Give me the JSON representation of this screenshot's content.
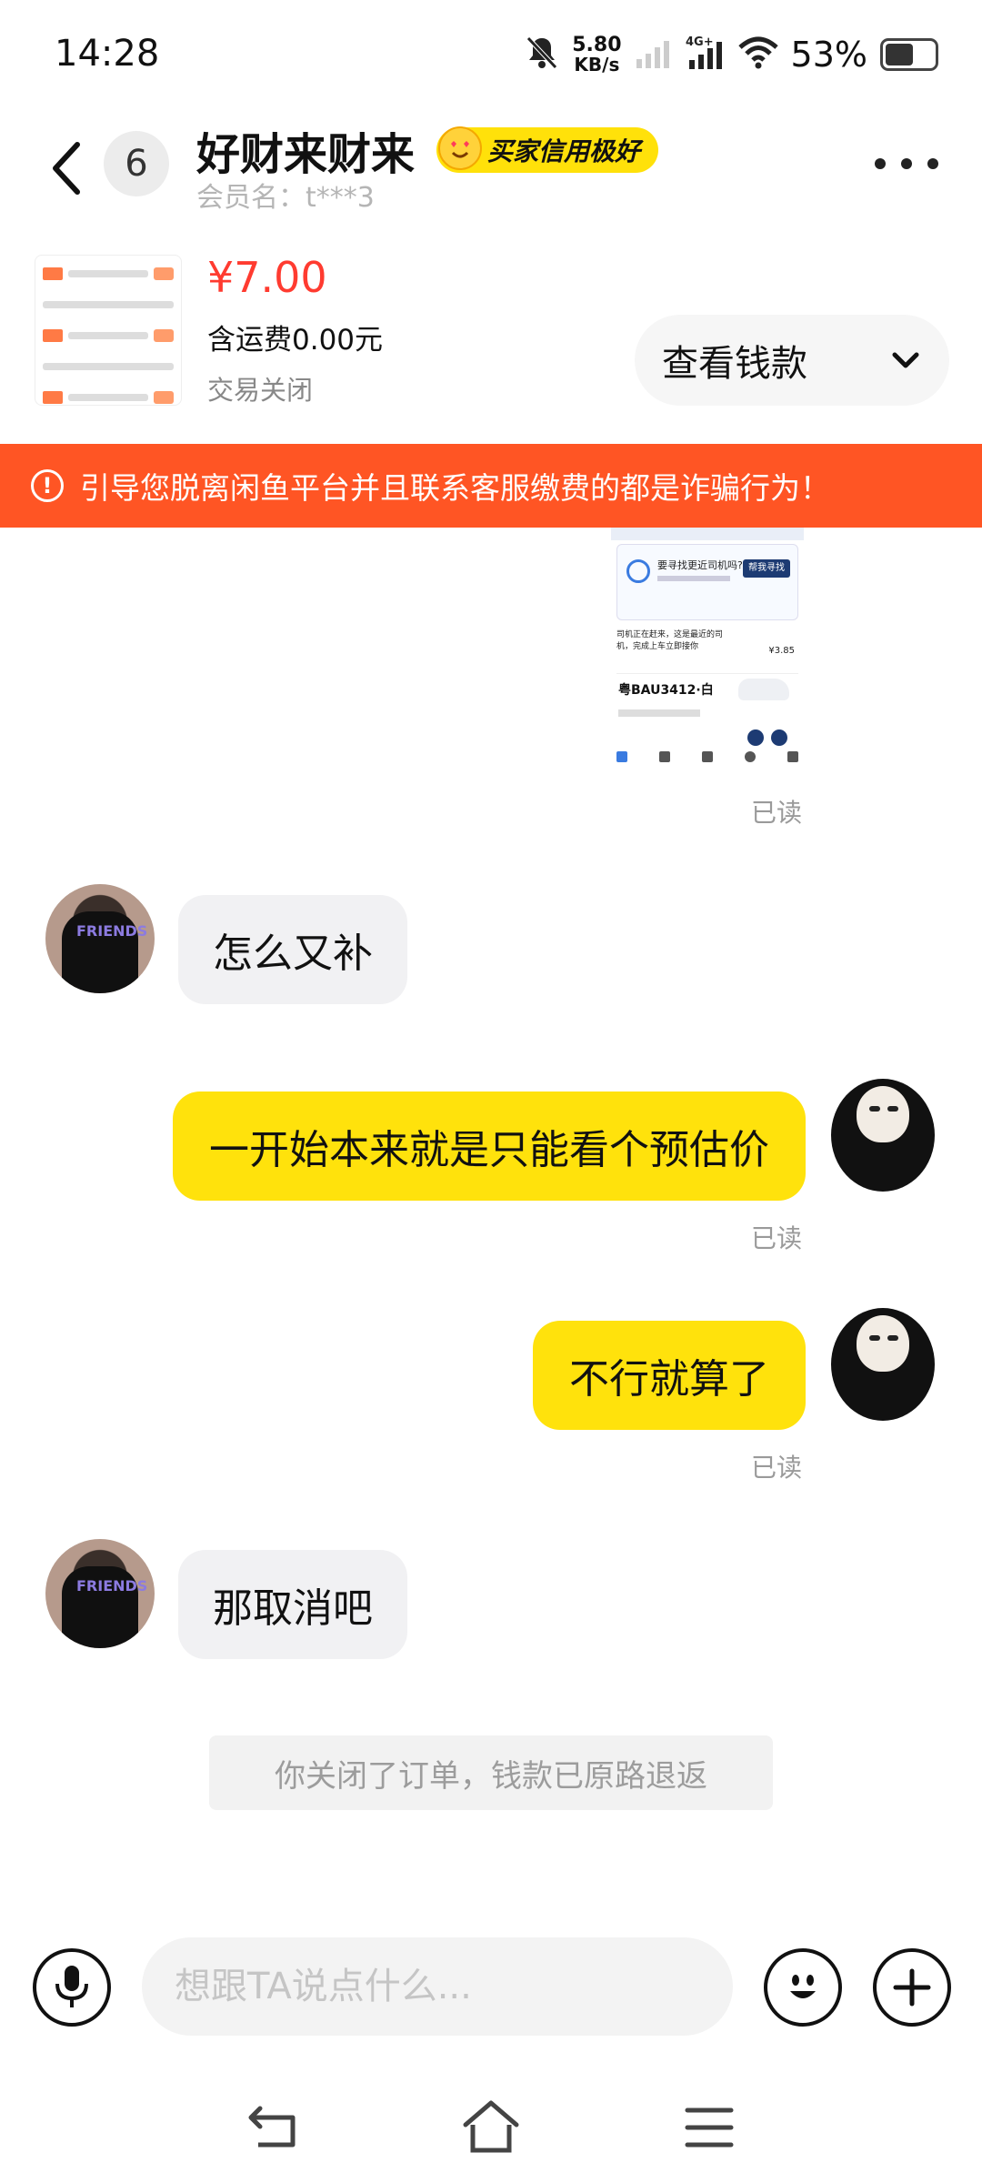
{
  "status_bar": {
    "time": "14:28",
    "net_speed_value": "5.80",
    "net_speed_unit": "KB/s",
    "network": "4G+",
    "battery": "53%"
  },
  "header": {
    "unread_count": "6",
    "peer_name": "好财来财来",
    "credit_badge": "买家信用极好",
    "member_name": "会员名：t***3"
  },
  "product": {
    "price": "¥7.00",
    "shipping": "含运费0.00元",
    "status": "交易关闭",
    "view_button": "查看钱款"
  },
  "warning": {
    "text": "引导您脱离闲鱼平台并且联系客服缴费的都是诈骗行为！"
  },
  "shared_image": {
    "search_title": "要寻找更近司机吗?",
    "search_button": "帮我寻找",
    "driver_note": "司机正在赶来，这是最近的司机，完成上车立即接你",
    "price": "¥3.85",
    "plate": "粤BAU3412·白"
  },
  "messages": [
    {
      "side": "peer",
      "text": "怎么又补"
    },
    {
      "side": "me",
      "text": "一开始本来就是只能看个预估价",
      "read": "已读"
    },
    {
      "side": "me",
      "text": "不行就算了",
      "read": "已读"
    },
    {
      "side": "peer",
      "text": "那取消吧"
    }
  ],
  "image_read": "已读",
  "system_notice": "你关闭了订单，钱款已原路退返",
  "input": {
    "placeholder": "想跟TA说点什么..."
  },
  "colors": {
    "accent_yellow": "#ffe20c",
    "warning_orange": "#ff5524",
    "price_red": "#ff3b30"
  }
}
